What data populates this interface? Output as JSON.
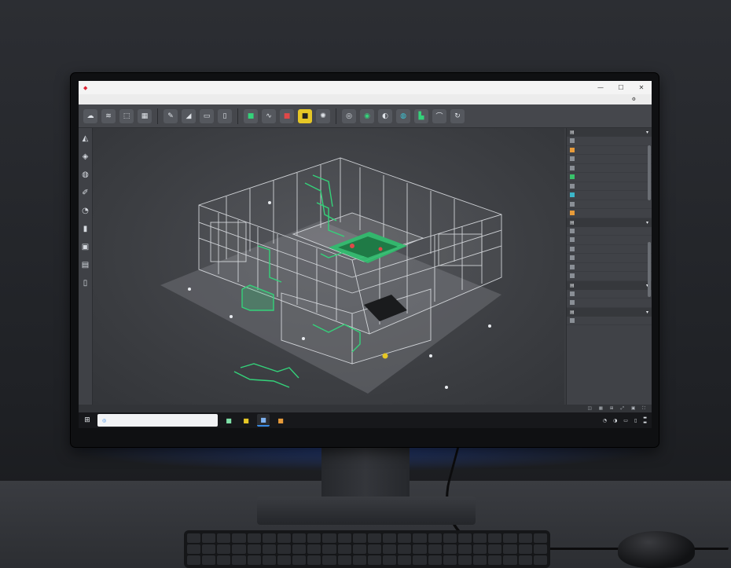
{
  "window": {
    "title": "",
    "controls": {
      "minimize": "—",
      "maximize": "☐",
      "close": "✕"
    }
  },
  "menu": {
    "items": [
      "",
      "",
      "",
      "",
      "",
      "",
      "",
      "",
      "",
      ""
    ]
  },
  "viewport": {
    "label": ""
  },
  "status": {
    "left": ""
  },
  "taskbar": {
    "search_placeholder": ""
  },
  "colors": {
    "accent_green": "#34d27a",
    "accent_yellow": "#e6c726",
    "accent_blue": "#3a8ce6",
    "accent_red": "#e04848"
  },
  "icons": {
    "left_tools": [
      "orbit-icon",
      "pan-icon",
      "zoom-icon",
      "pen-icon",
      "measure-icon",
      "section-icon",
      "cube-icon",
      "document-icon"
    ],
    "ribbon": [
      "cloud-icon",
      "layers-icon",
      "select-icon",
      "grid-icon",
      "pencil-icon",
      "erase-icon",
      "folder-icon",
      "save-icon",
      "render-icon",
      "wave-icon",
      "color-icon",
      "material-icon",
      "settings-icon",
      "component-icon",
      "robot-icon",
      "cycle-icon",
      "cloud-sync-icon",
      "chart-icon",
      "refresh-icon"
    ]
  }
}
